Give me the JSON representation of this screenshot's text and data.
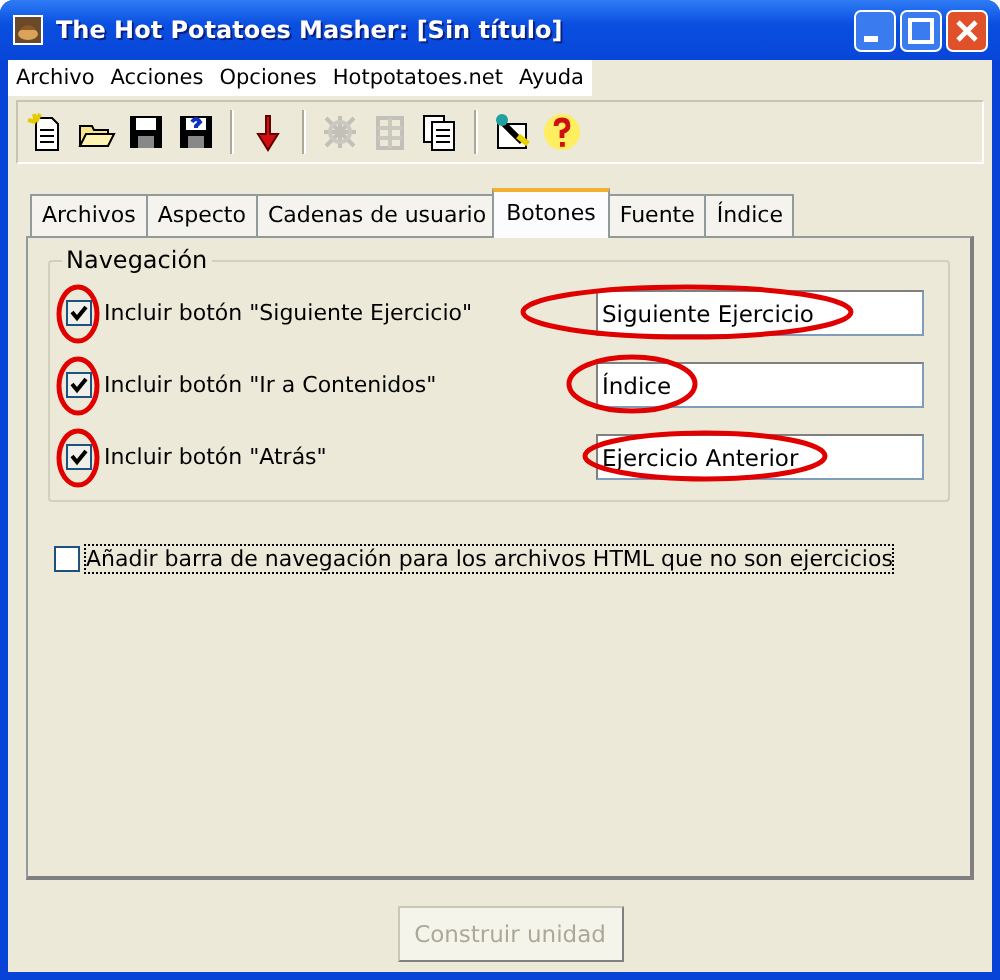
{
  "window": {
    "title": "The Hot Potatoes Masher: [Sin título]"
  },
  "menu": [
    "Archivo",
    "Acciones",
    "Opciones",
    "Hotpotatoes.net",
    "Ayuda"
  ],
  "toolbar": [
    {
      "kind": "new",
      "disabled": false
    },
    {
      "kind": "open",
      "disabled": false
    },
    {
      "kind": "save",
      "disabled": false
    },
    {
      "kind": "saveas",
      "disabled": false
    },
    {
      "kind": "sep"
    },
    {
      "kind": "arrow",
      "disabled": false
    },
    {
      "kind": "sep"
    },
    {
      "kind": "grid",
      "disabled": true
    },
    {
      "kind": "grid2",
      "disabled": true
    },
    {
      "kind": "pages",
      "disabled": false
    },
    {
      "kind": "sep"
    },
    {
      "kind": "wizard",
      "disabled": false
    },
    {
      "kind": "help",
      "disabled": false
    }
  ],
  "tabs": [
    {
      "label": "Archivos",
      "selected": false
    },
    {
      "label": "Aspecto",
      "selected": false
    },
    {
      "label": "Cadenas de usuario",
      "selected": false
    },
    {
      "label": "Botones",
      "selected": true
    },
    {
      "label": "Fuente",
      "selected": false
    },
    {
      "label": "Índice",
      "selected": false
    }
  ],
  "group": {
    "title": "Navegación",
    "rows": [
      {
        "label": "Incluir botón \"Siguiente Ejercicio\"",
        "checked": true,
        "value": "Siguiente Ejercicio",
        "circled": true
      },
      {
        "label": "Incluir botón \"Ir a Contenidos\"",
        "checked": true,
        "value": "Índice",
        "circled": true
      },
      {
        "label": "Incluir botón \"Atrás\"",
        "checked": true,
        "value": "Ejercicio Anterior",
        "circled": true
      }
    ]
  },
  "extra_option": {
    "label": "Añadir barra de navegación para los archivos HTML que no son ejercicios",
    "checked": false,
    "focused": true
  },
  "build_button": {
    "label": "Construir unidad",
    "disabled": true
  }
}
